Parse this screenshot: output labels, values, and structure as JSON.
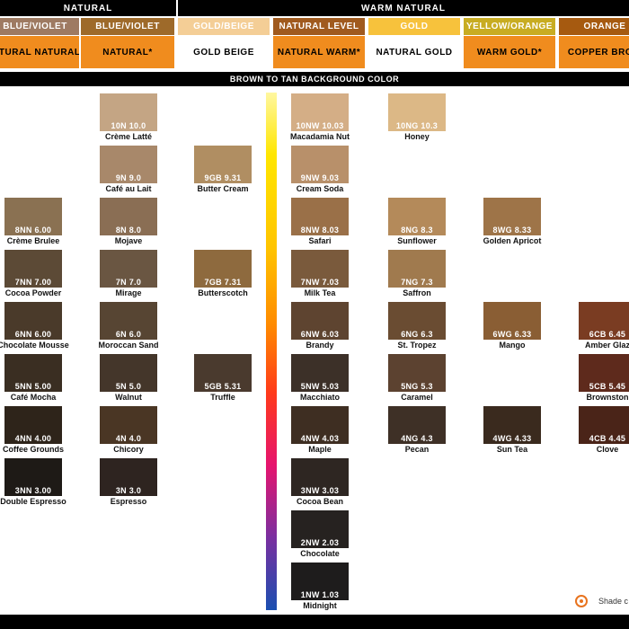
{
  "header": {
    "natural": "NATURAL",
    "warm_natural": "WARM NATURAL"
  },
  "categories": [
    {
      "label": "BLUE/VIOLET",
      "bg": "#9e7a62"
    },
    {
      "label": "BLUE/VIOLET",
      "bg": "#9e6a2a"
    },
    {
      "label": "GOLD/BEIGE",
      "bg": "#f4ce96"
    },
    {
      "label": "NATURAL LEVEL",
      "bg": "#a05a1e"
    },
    {
      "label": "GOLD",
      "bg": "#f7c23c"
    },
    {
      "label": "YELLOW/ORANGE",
      "bg": "#c8ac22"
    },
    {
      "label": "ORANGE",
      "bg": "#a65a10"
    }
  ],
  "lines": [
    {
      "label": "NATURAL NATURAL*",
      "bg": "#f08c1e"
    },
    {
      "label": "NATURAL*",
      "bg": "#f08c1e"
    },
    {
      "label": "GOLD BEIGE",
      "bg": "#ffffff"
    },
    {
      "label": "NATURAL WARM*",
      "bg": "#f08c1e"
    },
    {
      "label": "NATURAL GOLD",
      "bg": "#ffffff"
    },
    {
      "label": "WARM GOLD*",
      "bg": "#f08c1e"
    },
    {
      "label": "COPPER BROW",
      "bg": "#f08c1e"
    }
  ],
  "background_bar": "BROWN TO TAN BACKGROUND COLOR",
  "columns": [
    {
      "swatches": [
        {
          "code": "8NN 6.00",
          "name": "Crème Brulee",
          "color": "#8a7152",
          "row": 2
        },
        {
          "code": "7NN 7.00",
          "name": "Cocoa Powder",
          "color": "#5c4a36",
          "row": 3
        },
        {
          "code": "6NN 6.00",
          "name": "Chocolate Mousse",
          "color": "#4a3a2a",
          "row": 4
        },
        {
          "code": "5NN 5.00",
          "name": "Café Mocha",
          "color": "#3a2e22",
          "row": 5
        },
        {
          "code": "4NN 4.00",
          "name": "Coffee Grounds",
          "color": "#2e241a",
          "row": 6
        },
        {
          "code": "3NN 3.00",
          "name": "Double Espresso",
          "color": "#1e1a16",
          "row": 7
        }
      ]
    },
    {
      "swatches": [
        {
          "code": "10N 10.0",
          "name": "Crème Latté",
          "color": "#c4a584",
          "row": 0
        },
        {
          "code": "9N 9.0",
          "name": "Café au Lait",
          "color": "#a8886a",
          "row": 1
        },
        {
          "code": "8N 8.0",
          "name": "Mojave",
          "color": "#8a6e54",
          "row": 2
        },
        {
          "code": "7N 7.0",
          "name": "Mirage",
          "color": "#6a5642",
          "row": 3
        },
        {
          "code": "6N 6.0",
          "name": "Moroccan Sand",
          "color": "#574533",
          "row": 4
        },
        {
          "code": "5N 5.0",
          "name": "Walnut",
          "color": "#44362a",
          "row": 5
        },
        {
          "code": "4N 4.0",
          "name": "Chicory",
          "color": "#4a3624",
          "row": 6
        },
        {
          "code": "3N 3.0",
          "name": "Espresso",
          "color": "#2e2420",
          "row": 7
        }
      ]
    },
    {
      "swatches": [
        {
          "code": "9GB 9.31",
          "name": "Butter Cream",
          "color": "#b08e62",
          "row": 1
        },
        {
          "code": "7GB 7.31",
          "name": "Butterscotch",
          "color": "#8e6a3e",
          "row": 3
        },
        {
          "code": "5GB 5.31",
          "name": "Truffle",
          "color": "#4a3a2e",
          "row": 5
        }
      ]
    },
    {
      "swatches": [
        {
          "code": "10NW 10.03",
          "name": "Macadamia Nut",
          "color": "#d4ae86",
          "row": 0
        },
        {
          "code": "9NW 9.03",
          "name": "Cream Soda",
          "color": "#b8906a",
          "row": 1
        },
        {
          "code": "8NW 8.03",
          "name": "Safari",
          "color": "#9a7048",
          "row": 2
        },
        {
          "code": "7NW 7.03",
          "name": "Milk Tea",
          "color": "#7a5a3c",
          "row": 3
        },
        {
          "code": "6NW 6.03",
          "name": "Brandy",
          "color": "#5e4430",
          "row": 4
        },
        {
          "code": "5NW 5.03",
          "name": "Macchiato",
          "color": "#3c3028",
          "row": 5
        },
        {
          "code": "4NW 4.03",
          "name": "Maple",
          "color": "#3e2e22",
          "row": 6
        },
        {
          "code": "3NW 3.03",
          "name": "Cocoa Bean",
          "color": "#2e2622",
          "row": 7
        },
        {
          "code": "2NW 2.03",
          "name": "Chocolate",
          "color": "#262220",
          "row": 8
        },
        {
          "code": "1NW 1.03",
          "name": "Midnight",
          "color": "#1e1c1c",
          "row": 9
        }
      ]
    },
    {
      "swatches": [
        {
          "code": "10NG 10.3",
          "name": "Honey",
          "color": "#dcb886",
          "row": 0
        },
        {
          "code": "8NG 8.3",
          "name": "Sunflower",
          "color": "#b48a5a",
          "row": 2
        },
        {
          "code": "7NG 7.3",
          "name": "Saffron",
          "color": "#a07a4e",
          "row": 3
        },
        {
          "code": "6NG 6.3",
          "name": "St. Tropez",
          "color": "#6a4c32",
          "row": 4
        },
        {
          "code": "5NG 5.3",
          "name": "Caramel",
          "color": "#5c4230",
          "row": 5
        },
        {
          "code": "4NG 4.3",
          "name": "Pecan",
          "color": "#3e3026",
          "row": 6
        }
      ]
    },
    {
      "swatches": [
        {
          "code": "8WG 8.33",
          "name": "Golden Apricot",
          "color": "#9e7448",
          "row": 2
        },
        {
          "code": "6WG 6.33",
          "name": "Mango",
          "color": "#8a5e34",
          "row": 4
        },
        {
          "code": "4WG 4.33",
          "name": "Sun Tea",
          "color": "#3a2a1e",
          "row": 6
        }
      ]
    },
    {
      "swatches": [
        {
          "code": "6CB 6.45",
          "name": "Amber Glaz",
          "color": "#7a3c22",
          "row": 4
        },
        {
          "code": "5CB 5.45",
          "name": "Brownston",
          "color": "#5e2a1c",
          "row": 5
        },
        {
          "code": "4CB 4.45",
          "name": "Clove",
          "color": "#4a2418",
          "row": 6
        }
      ]
    }
  ],
  "footer": {
    "text": "Shade c"
  }
}
